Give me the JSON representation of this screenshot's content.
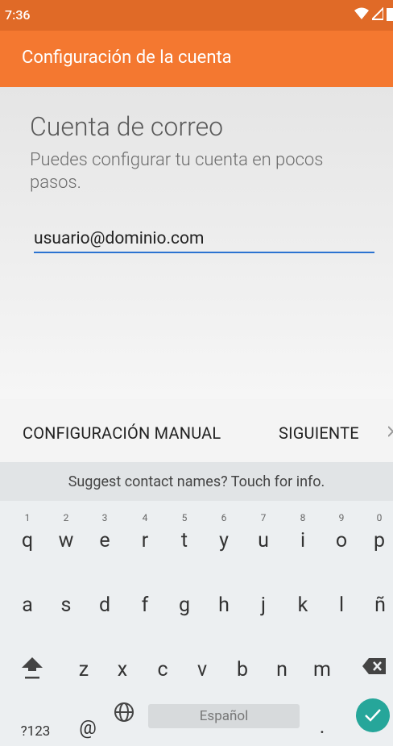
{
  "status_bar": {
    "time": "7:36"
  },
  "app_bar": {
    "title": "Configuración de la cuenta"
  },
  "form": {
    "heading": "Cuenta de correo",
    "subtitle": "Puedes configurar tu cuenta en pocos pasos.",
    "email_value": "usuario@dominio.com"
  },
  "actions": {
    "manual_label": "CONFIGURACIÓN MANUAL",
    "next_label": "SIGUIENTE"
  },
  "keyboard": {
    "suggestion": "Suggest contact names? Touch for info.",
    "row1": [
      {
        "k": "q",
        "h": "1"
      },
      {
        "k": "w",
        "h": "2"
      },
      {
        "k": "e",
        "h": "3"
      },
      {
        "k": "r",
        "h": "4"
      },
      {
        "k": "t",
        "h": "5"
      },
      {
        "k": "y",
        "h": "6"
      },
      {
        "k": "u",
        "h": "7"
      },
      {
        "k": "i",
        "h": "8"
      },
      {
        "k": "o",
        "h": "9"
      },
      {
        "k": "p",
        "h": "0"
      }
    ],
    "row2": [
      "a",
      "s",
      "d",
      "f",
      "g",
      "h",
      "j",
      "k",
      "l",
      "ñ"
    ],
    "row3": [
      "z",
      "x",
      "c",
      "v",
      "b",
      "n",
      "m"
    ],
    "symbols_label": "?123",
    "at_label": "@",
    "space_label": "Español",
    "period_label": "."
  },
  "colors": {
    "accent": "#f47830",
    "status_bar": "#e06a27",
    "field_underline": "#2b73d1",
    "enter_key": "#26a69a"
  }
}
